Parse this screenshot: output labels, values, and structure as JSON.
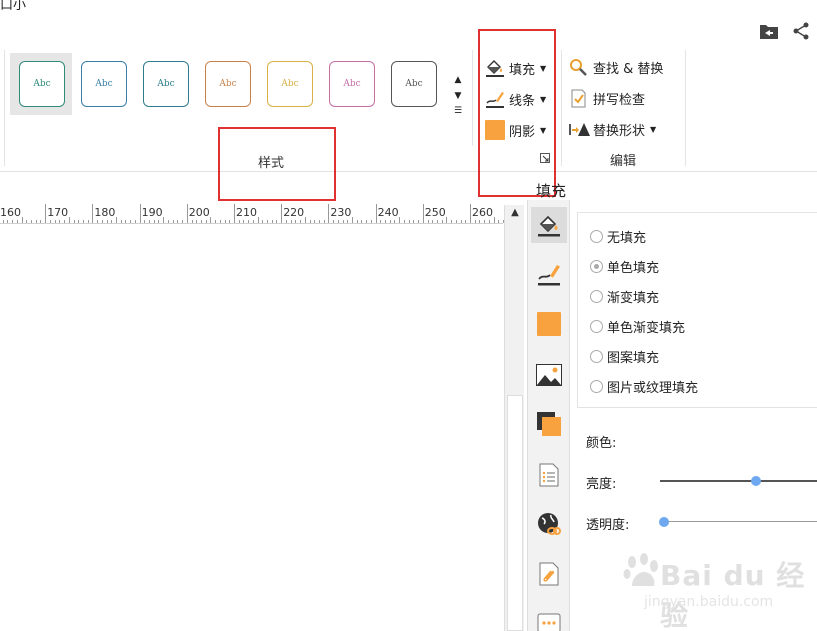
{
  "top_cut_text": "口小",
  "ribbon": {
    "styles_group_label": "样式",
    "edit_group_label": "编辑",
    "style_tiles": [
      {
        "text": "Abc",
        "color": "#2e8b7a"
      },
      {
        "text": "Abc",
        "color": "#3a7fa8"
      },
      {
        "text": "Abc",
        "color": "#2d7d8c"
      },
      {
        "text": "Abc",
        "color": "#c9824a"
      },
      {
        "text": "Abc",
        "color": "#d8b04a"
      },
      {
        "text": "Abc",
        "color": "#c56fa6"
      },
      {
        "text": "Abc",
        "color": "#555555"
      }
    ],
    "fill_label": "填充",
    "line_label": "线条",
    "shadow_label": "阴影",
    "find_replace_label": "查找 & 替换",
    "spellcheck_label": "拼写检查",
    "replace_shape_label": "替换形状",
    "shadow_color": "#f7a23f"
  },
  "ruler": {
    "labels": [
      "160",
      "170",
      "180",
      "190",
      "200",
      "210",
      "220",
      "230",
      "240",
      "250",
      "260"
    ]
  },
  "panel": {
    "title": "填充",
    "options": [
      {
        "label": "无填充",
        "selected": false
      },
      {
        "label": "单色填充",
        "selected": true
      },
      {
        "label": "渐变填充",
        "selected": false
      },
      {
        "label": "单色渐变填充",
        "selected": false
      },
      {
        "label": "图案填充",
        "selected": false
      },
      {
        "label": "图片或纹理填充",
        "selected": false
      }
    ],
    "color_label": "颜色:",
    "brightness_label": "亮度:",
    "transparency_label": "透明度:",
    "brightness_value": 0.61,
    "transparency_value": 0.0
  },
  "watermark": {
    "brand": "Bai du 经验",
    "url": "jingyan.baidu.com"
  }
}
